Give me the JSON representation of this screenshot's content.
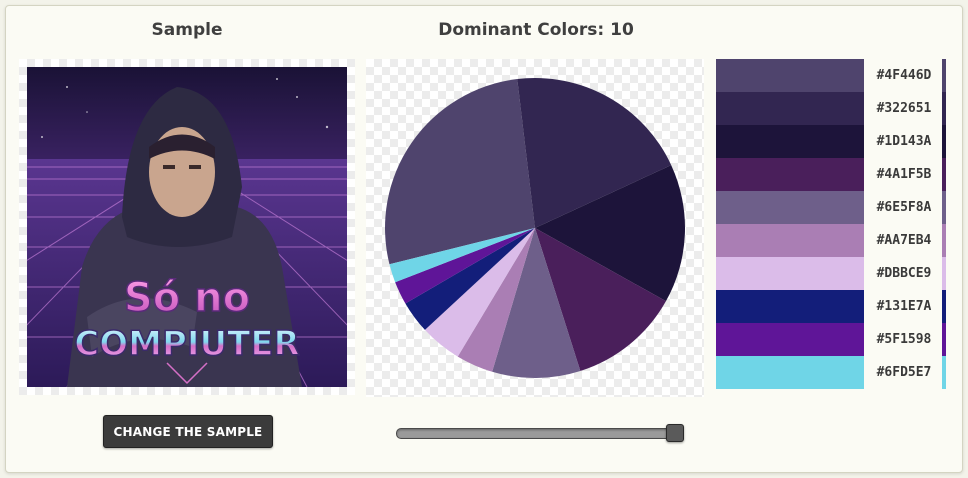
{
  "sample": {
    "heading": "Sample",
    "image_text_line1": "Só no",
    "image_text_line2": "COMPIUTER",
    "change_button_label": "CHANGE THE SAMPLE"
  },
  "palette": {
    "heading": "Dominant Colors: 10",
    "slider_value": 10,
    "slider_max": 10,
    "colors": [
      {
        "hex": "#4F446D",
        "label": "#4F446D",
        "share": 0.27
      },
      {
        "hex": "#322651",
        "label": "#322651",
        "share": 0.2
      },
      {
        "hex": "#1D143A",
        "label": "#1D143A",
        "share": 0.15
      },
      {
        "hex": "#4A1F5B",
        "label": "#4A1F5B",
        "share": 0.12
      },
      {
        "hex": "#6E5F8A",
        "label": "#6E5F8A",
        "share": 0.095
      },
      {
        "hex": "#AA7EB4",
        "label": "#AA7EB4",
        "share": 0.04
      },
      {
        "hex": "#DBBCE9",
        "label": "#DBBCE9",
        "share": 0.045
      },
      {
        "hex": "#131E7A",
        "label": "#131E7A",
        "share": 0.035
      },
      {
        "hex": "#5F1598",
        "label": "#5F1598",
        "share": 0.025
      },
      {
        "hex": "#6FD5E7",
        "label": "#6FD5E7",
        "share": 0.02
      }
    ]
  }
}
